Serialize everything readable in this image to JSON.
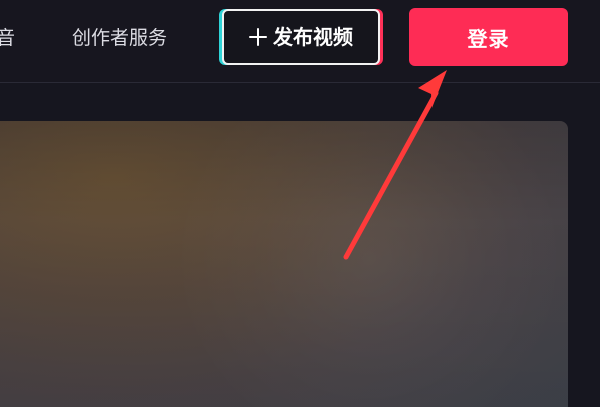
{
  "header": {
    "nav": {
      "cut_label": "音",
      "creator_label": "创作者服务"
    },
    "publish_label": "发布视频",
    "login_label": "登录"
  },
  "icons": {
    "plus": "plus-icon"
  },
  "colors": {
    "background": "#16161f",
    "login_button": "#fe2c55",
    "publish_border": "#f2f2f2",
    "accent_cyan": "#2fd3d7",
    "annotation_arrow": "#ff3a3a"
  }
}
